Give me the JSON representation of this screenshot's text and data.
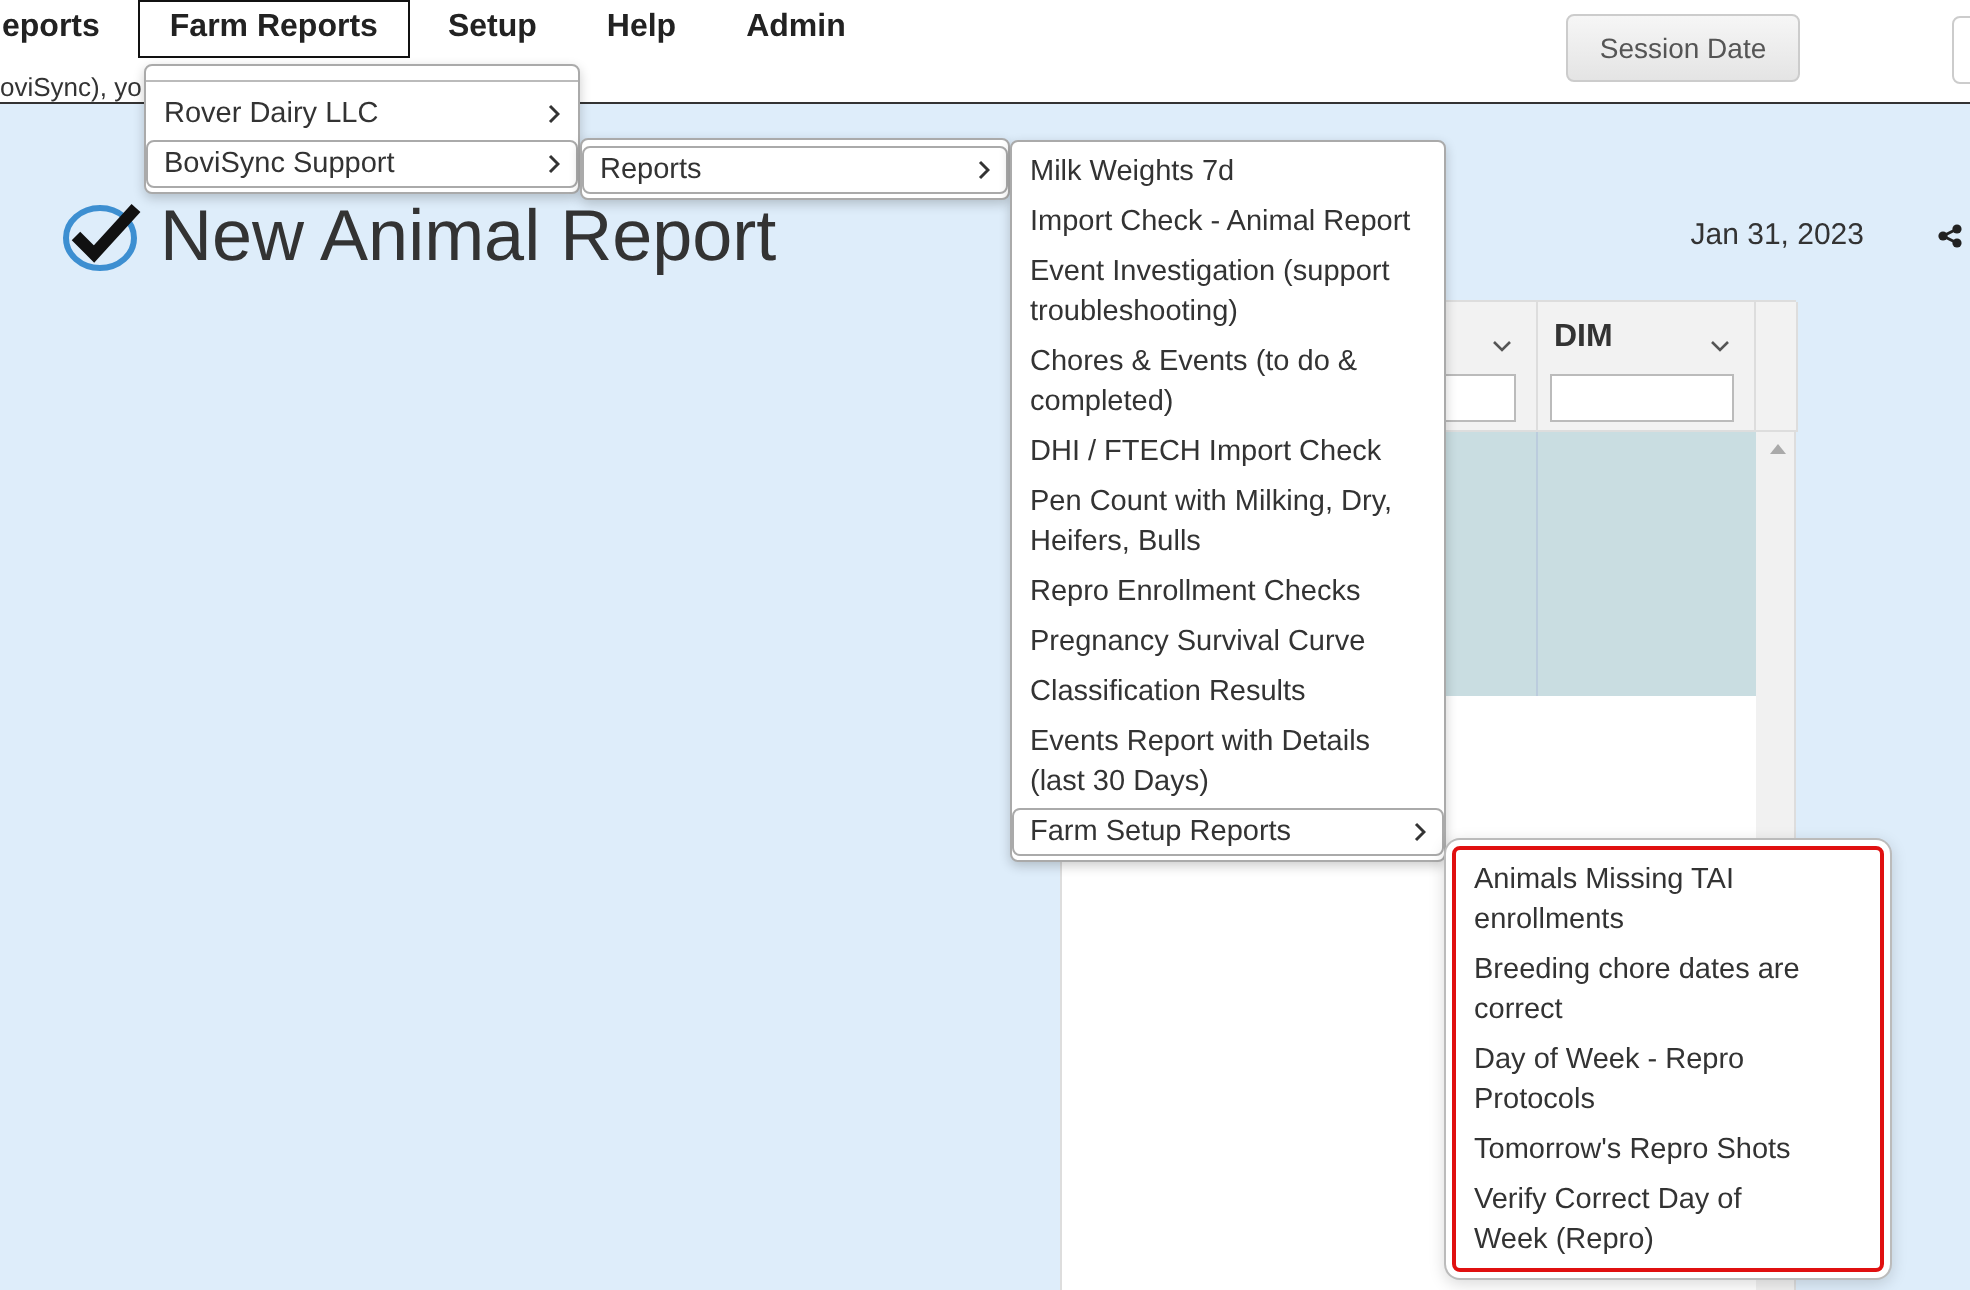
{
  "nav": {
    "items": [
      {
        "label": "eports",
        "selected": false
      },
      {
        "label": "Farm Reports",
        "selected": true
      },
      {
        "label": "Setup",
        "selected": false
      },
      {
        "label": "Help",
        "selected": false
      },
      {
        "label": "Admin",
        "selected": false
      }
    ],
    "session_button": "Session Date"
  },
  "subtitle": "oviSync), yo",
  "page": {
    "title": "New Animal Report",
    "date": "Jan 31, 2023"
  },
  "table": {
    "columns": [
      {
        "kind": "covered"
      },
      {
        "kind": "labeled",
        "label": "DIM"
      }
    ],
    "rows": [
      {
        "selected": true
      }
    ]
  },
  "menu": {
    "items": [
      {
        "label": "Rover Dairy LLC",
        "has_submenu": true,
        "selected": false
      },
      {
        "label": "BoviSync Support",
        "has_submenu": true,
        "selected": true,
        "submenu": {
          "items": [
            {
              "label": "Reports",
              "has_submenu": true,
              "selected": true,
              "submenu": {
                "items": [
                  {
                    "label": "Milk Weights 7d",
                    "has_submenu": false,
                    "selected": false
                  },
                  {
                    "label": "Import Check - Animal Report",
                    "has_submenu": false,
                    "selected": false
                  },
                  {
                    "label": "Event Investigation (support troubleshooting)",
                    "has_submenu": false,
                    "selected": false
                  },
                  {
                    "label": "Chores & Events (to do & completed)",
                    "has_submenu": false,
                    "selected": false
                  },
                  {
                    "label": "DHI / FTECH Import Check",
                    "has_submenu": false,
                    "selected": false
                  },
                  {
                    "label": "Pen Count with Milking, Dry, Heifers, Bulls",
                    "has_submenu": false,
                    "selected": false
                  },
                  {
                    "label": "Repro Enrollment Checks",
                    "has_submenu": false,
                    "selected": false
                  },
                  {
                    "label": "Pregnancy Survival Curve",
                    "has_submenu": false,
                    "selected": false
                  },
                  {
                    "label": "Classification Results",
                    "has_submenu": false,
                    "selected": false
                  },
                  {
                    "label": "Events Report with Details (last 30 Days)",
                    "has_submenu": false,
                    "selected": false
                  },
                  {
                    "label": "Farm Setup Reports",
                    "has_submenu": true,
                    "selected": true,
                    "submenu": {
                      "highlighted": true,
                      "items": [
                        {
                          "label": "Animals Missing TAI enrollments",
                          "has_submenu": false,
                          "selected": false
                        },
                        {
                          "label": "Breeding chore dates are correct",
                          "has_submenu": false,
                          "selected": false
                        },
                        {
                          "label": "Day of Week - Repro Protocols",
                          "has_submenu": false,
                          "selected": false
                        },
                        {
                          "label": "Tomorrow's Repro Shots",
                          "has_submenu": false,
                          "selected": false
                        },
                        {
                          "label": "Verify Correct Day of Week (Repro)",
                          "has_submenu": false,
                          "selected": false
                        }
                      ]
                    }
                  }
                ]
              }
            }
          ]
        }
      }
    ]
  }
}
